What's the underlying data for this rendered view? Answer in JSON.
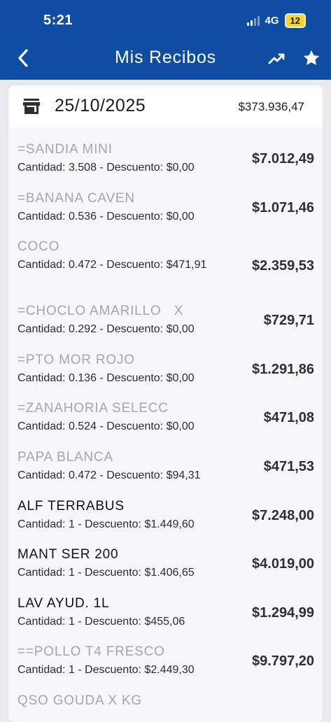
{
  "status_bar": {
    "time": "5:21",
    "network": "4G",
    "battery": "12"
  },
  "header": {
    "title": "Mis Recibos",
    "back_icon": "chevron-left-icon",
    "trend_icon": "trending-up-icon",
    "star_icon": "star-icon"
  },
  "receipt": {
    "date": "25/10/2025",
    "total": "$373.936,47",
    "store_icon": "store-icon",
    "items": [
      {
        "name": "=SANDIA MINI",
        "detail": "Cantidad: 3.508  -  Descuento: $0,00",
        "price": "$7.012,49"
      },
      {
        "name": "=BANANA CAVEN",
        "detail": "Cantidad: 0.536  -  Descuento: $0,00",
        "price": "$1.071,46"
      },
      {
        "name": "COCO",
        "detail": "Cantidad: 0.472  -  Descuento: $471,91",
        "price": "$2.359,53"
      },
      {
        "name": "=CHOCLO AMARILLO   X",
        "detail": "Cantidad: 0.292  -  Descuento: $0,00",
        "price": "$729,71"
      },
      {
        "name": "=PTO MOR ROJO",
        "detail": "Cantidad: 0.136  -  Descuento: $0,00",
        "price": "$1.291,86"
      },
      {
        "name": "=ZANAHORIA SELECC",
        "detail": "Cantidad: 0.524  -  Descuento: $0,00",
        "price": "$471,08"
      },
      {
        "name": "PAPA BLANCA",
        "detail": "Cantidad: 0.472  -  Descuento: $94,31",
        "price": "$471,53"
      },
      {
        "name": "ALF TERRABUS",
        "detail": "Cantidad: 1  -  Descuento: $1.449,60",
        "price": "$7.248,00"
      },
      {
        "name": "MANT SER 200",
        "detail": "Cantidad: 1  -  Descuento: $1.406,65",
        "price": "$4.019,00"
      },
      {
        "name": "LAV AYUD. 1L",
        "detail": "Cantidad: 1  -  Descuento: $455,06",
        "price": "$1.294,99"
      },
      {
        "name": "==POLLO T4 FRESCO",
        "detail": "Cantidad: 1  -  Descuento: $2.449,30",
        "price": "$9.797,20"
      },
      {
        "name": "QSO GOUDA X KG",
        "detail": "",
        "price": ""
      }
    ]
  }
}
